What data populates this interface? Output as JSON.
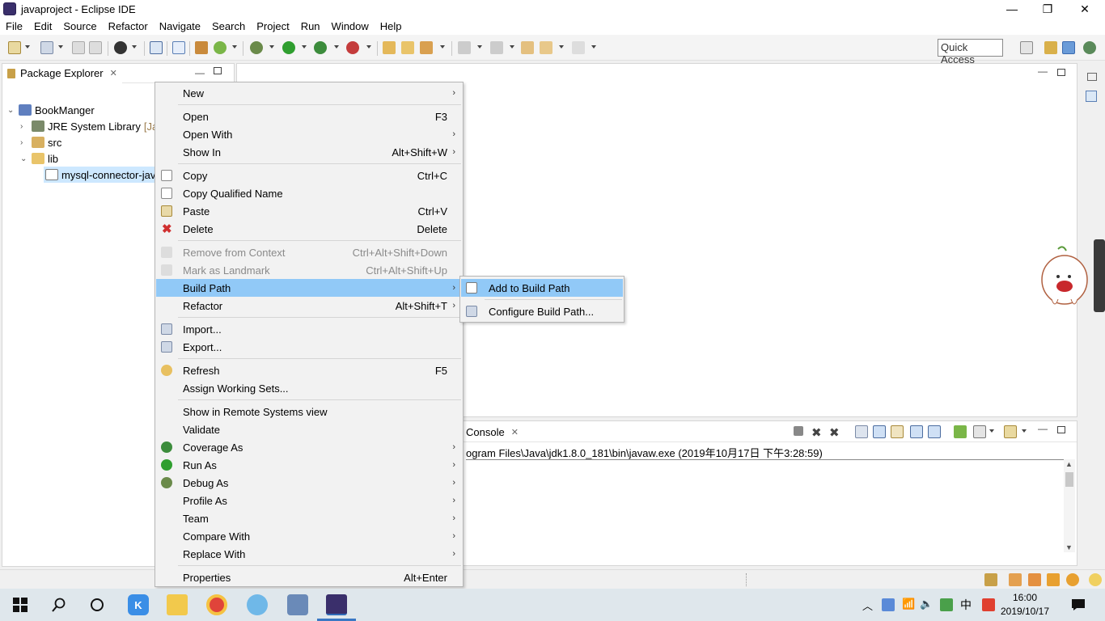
{
  "window": {
    "title": "javaproject - Eclipse IDE",
    "min": "—",
    "restore": "❐",
    "close": "✕"
  },
  "menubar": [
    "File",
    "Edit",
    "Source",
    "Refactor",
    "Navigate",
    "Search",
    "Project",
    "Run",
    "Window",
    "Help"
  ],
  "toolbar": {
    "quick_access": "Quick Access"
  },
  "package_explorer": {
    "tab_label": "Package Explorer",
    "tree": [
      {
        "label": "BookManger",
        "twisty": "⌄"
      },
      {
        "label": "JRE System Library",
        "suffix": "[Ja",
        "twisty": "›"
      },
      {
        "label": "src",
        "twisty": "›"
      },
      {
        "label": "lib",
        "twisty": "⌄"
      },
      {
        "label": "mysql-connector-jav"
      }
    ]
  },
  "console": {
    "tab_label": "Console",
    "path_text": "ogram Files\\Java\\jdk1.8.0_181\\bin\\javaw.exe (2019年10月17日 下午3:28:59)"
  },
  "context_menu": {
    "items": [
      {
        "label": "New",
        "submenu": true
      },
      {
        "label": "Open",
        "shortcut": "F3"
      },
      {
        "label": "Open With",
        "submenu": true
      },
      {
        "label": "Show In",
        "shortcut": "Alt+Shift+W",
        "submenu": true
      },
      {
        "label": "Copy",
        "shortcut": "Ctrl+C"
      },
      {
        "label": "Copy Qualified Name"
      },
      {
        "label": "Paste",
        "shortcut": "Ctrl+V"
      },
      {
        "label": "Delete",
        "shortcut": "Delete"
      },
      {
        "label": "Remove from Context",
        "shortcut": "Ctrl+Alt+Shift+Down",
        "disabled": true
      },
      {
        "label": "Mark as Landmark",
        "shortcut": "Ctrl+Alt+Shift+Up",
        "disabled": true
      },
      {
        "label": "Build Path",
        "submenu": true,
        "highlighted": true
      },
      {
        "label": "Refactor",
        "shortcut": "Alt+Shift+T",
        "submenu": true
      },
      {
        "label": "Import..."
      },
      {
        "label": "Export..."
      },
      {
        "label": "Refresh",
        "shortcut": "F5"
      },
      {
        "label": "Assign Working Sets..."
      },
      {
        "label": "Show in Remote Systems view"
      },
      {
        "label": "Validate"
      },
      {
        "label": "Coverage As",
        "submenu": true
      },
      {
        "label": "Run As",
        "submenu": true
      },
      {
        "label": "Debug As",
        "submenu": true
      },
      {
        "label": "Profile As",
        "submenu": true
      },
      {
        "label": "Team",
        "submenu": true
      },
      {
        "label": "Compare With",
        "submenu": true
      },
      {
        "label": "Replace With",
        "submenu": true
      },
      {
        "label": "Properties",
        "shortcut": "Alt+Enter"
      }
    ],
    "submenu_arrow": "›"
  },
  "build_path_submenu": {
    "items": [
      {
        "label": "Add to Build Path",
        "highlighted": true
      },
      {
        "label": "Configure Build Path..."
      }
    ]
  },
  "taskbar": {
    "clock_time": "16:00",
    "clock_date": "2019/10/17",
    "ime": "中"
  },
  "colors": {
    "menu_highlight": "#91c9f7",
    "selection": "#cde8ff",
    "taskbar": "#dfe7ec"
  }
}
